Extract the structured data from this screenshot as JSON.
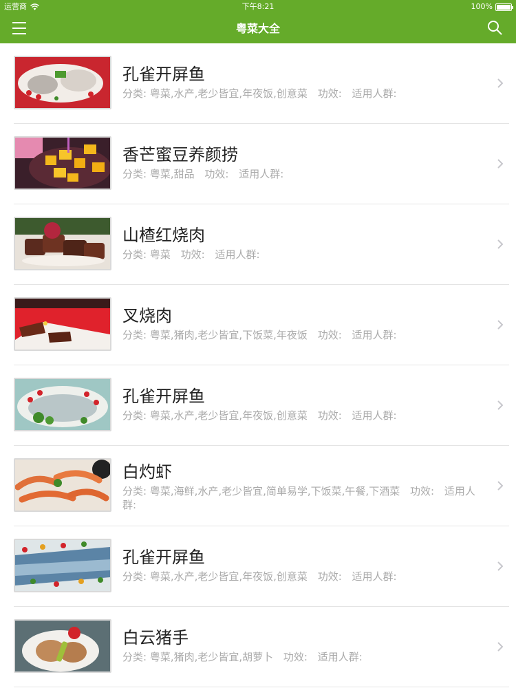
{
  "status": {
    "carrier": "运营商",
    "time": "下午8:21",
    "battery": "100%"
  },
  "nav": {
    "title": "粤菜大全"
  },
  "colors": {
    "nav_green": "#65ab2a"
  },
  "icons": {
    "menu": "hamburger-menu-icon",
    "search": "search-icon",
    "chevron": "chevron-right-icon"
  },
  "recipes": [
    {
      "title": "孔雀开屏鱼",
      "category": "分类: 粤菜,水产,老少皆宜,年夜饭,创意菜",
      "efficacy": "功效:",
      "audience": "适用人群:"
    },
    {
      "title": "香芒蜜豆养颜捞",
      "category": "分类: 粤菜,甜品",
      "efficacy": "功效:",
      "audience": "适用人群:"
    },
    {
      "title": "山楂红烧肉",
      "category": "分类: 粤菜",
      "efficacy": "功效:",
      "audience": "适用人群:"
    },
    {
      "title": "叉烧肉",
      "category": "分类: 粤菜,猪肉,老少皆宜,下饭菜,年夜饭",
      "efficacy": "功效:",
      "audience": "适用人群:"
    },
    {
      "title": "孔雀开屏鱼",
      "category": "分类: 粤菜,水产,老少皆宜,年夜饭,创意菜",
      "efficacy": "功效:",
      "audience": "适用人群:"
    },
    {
      "title": "白灼虾",
      "category": "分类: 粤菜,海鲜,水产,老少皆宜,简单易学,下饭菜,午餐,下酒菜",
      "efficacy": "功效:",
      "audience": "适用人群:"
    },
    {
      "title": "孔雀开屏鱼",
      "category": "分类: 粤菜,水产,老少皆宜,年夜饭,创意菜",
      "efficacy": "功效:",
      "audience": "适用人群:"
    },
    {
      "title": "白云猪手",
      "category": "分类: 粤菜,猪肉,老少皆宜,胡萝卜",
      "efficacy": "功效:",
      "audience": "适用人群:"
    }
  ]
}
